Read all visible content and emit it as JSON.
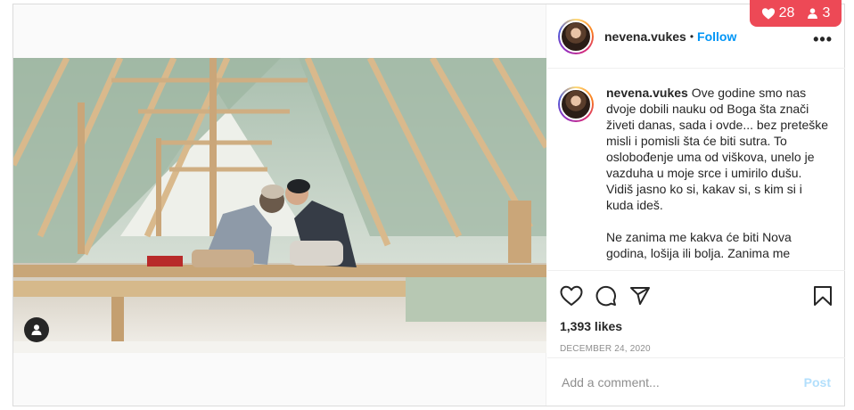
{
  "post": {
    "username": "nevena.vukes",
    "follow_label": "Follow",
    "separator": "•",
    "more_label": "•••",
    "caption_para1": "Ove godine smo nas dvoje dobili nauku od Boga šta znači živeti danas, sada i ovde... bez preteške misli i pomisli šta će biti sutra. To oslobođenje uma od viškova, unelo je vazduha u moje srce i umirilo dušu. Vidiš jasno ko si, kakav si, s kim si i kuda ideš.",
    "caption_para2": "Ne zanima me kakva će biti Nova godina, lošija ili bolja. Zanima me",
    "likes": "1,393 likes",
    "date": "December 24, 2020",
    "comment_placeholder": "Add a comment...",
    "post_label": "Post"
  },
  "badge": {
    "likes_count": "28",
    "people_count": "3"
  },
  "icons": {
    "like": "heart-icon",
    "comment": "comment-icon",
    "share": "share-icon",
    "save": "bookmark-icon",
    "tag": "user-tag-icon"
  },
  "colors": {
    "follow": "#0095f6",
    "badge": "#ed4956",
    "post_disabled": "#b2dffc"
  }
}
